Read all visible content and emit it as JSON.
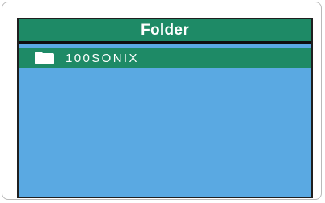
{
  "screen": {
    "title": "Folder",
    "items": [
      {
        "label": "100SONIX",
        "icon": "folder-icon",
        "selected": true
      }
    ]
  },
  "colors": {
    "title_bar": "#1e8a66",
    "background": "#5aa9e2",
    "selected_item": "#1e8a66",
    "text": "#ffffff"
  }
}
